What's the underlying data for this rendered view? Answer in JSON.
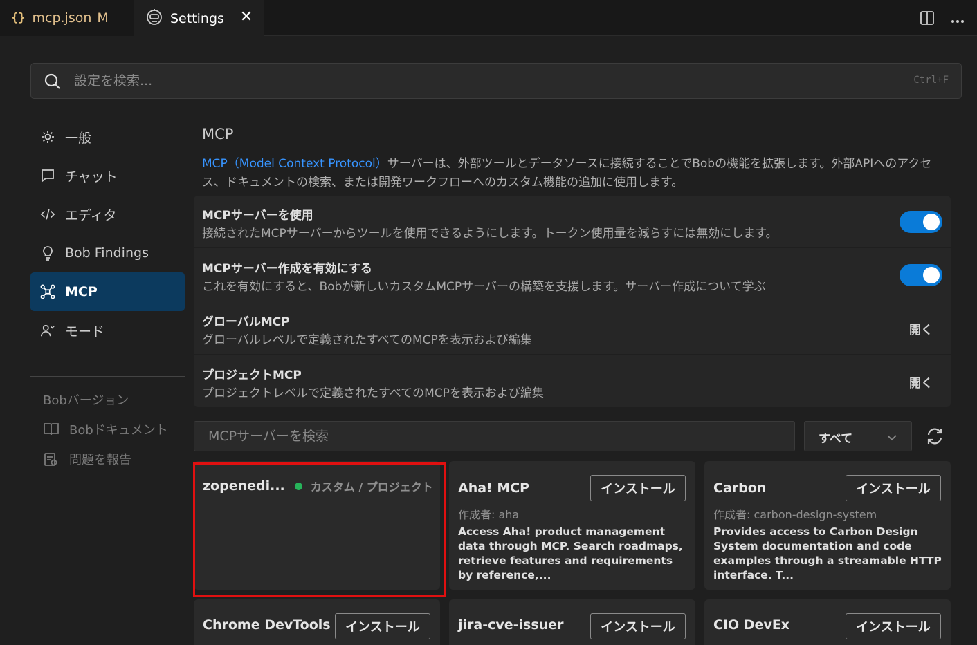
{
  "tabs": [
    {
      "icon": "json-braces-icon",
      "label": "mcp.json",
      "modified": "M"
    },
    {
      "icon": "settings-robot-icon",
      "label": "Settings",
      "close": "✕"
    }
  ],
  "search": {
    "placeholder": "設定を検索...",
    "shortcut": "Ctrl+F"
  },
  "sidebar": {
    "items": [
      {
        "icon": "gear-icon",
        "label": "一般"
      },
      {
        "icon": "chat-icon",
        "label": "チャット"
      },
      {
        "icon": "code-icon",
        "label": "エディタ"
      },
      {
        "icon": "lightbulb-icon",
        "label": "Bob Findings"
      },
      {
        "icon": "mcp-icon",
        "label": "MCP",
        "active": true
      },
      {
        "icon": "person-icon",
        "label": "モード"
      }
    ],
    "version": "Bobバージョン",
    "links": [
      {
        "icon": "book-icon",
        "label": "Bobドキュメント"
      },
      {
        "icon": "report-icon",
        "label": "問題を報告"
      }
    ]
  },
  "main": {
    "title": "MCP",
    "desc_link": "MCP（Model Context Protocol）",
    "desc_rest": "サーバーは、外部ツールとデータソースに接続することでBobの機能を拡張します。外部APIへのアクセス、ドキュメントの検索、または開発ワークフローへのカスタム機能の追加に使用します。",
    "settings": [
      {
        "title": "MCPサーバーを使用",
        "desc": "接続されたMCPサーバーからツールを使用できるようにします。トークン使用量を減らすには無効にします。",
        "toggle": true
      },
      {
        "title": "MCPサーバー作成を有効にする",
        "desc": "これを有効にすると、Bobが新しいカスタムMCPサーバーの構築を支援します。サーバー作成について学ぶ",
        "toggle": true
      },
      {
        "title": "グローバルMCP",
        "desc": "グローバルレベルで定義されたすべてのMCPを表示および編集",
        "action": "開く"
      },
      {
        "title": "プロジェクトMCP",
        "desc": "プロジェクトレベルで定義されたすべてのMCPを表示および編集",
        "action": "開く"
      }
    ],
    "server_search_placeholder": "MCPサーバーを検索",
    "filter_value": "すべて",
    "cards": [
      {
        "name": "zopenedi...",
        "status": "active",
        "tag": "カスタム / プロジェクト"
      },
      {
        "name": "Aha! MCP",
        "install": "インストール",
        "author": "作成者: aha",
        "desc": "Access Aha! product management data through MCP. Search roadmaps, retrieve features and requirements by reference,..."
      },
      {
        "name": "Carbon",
        "install": "インストール",
        "author": "作成者: carbon-design-system",
        "desc": "Provides access to Carbon Design System documentation and code examples through a streamable HTTP interface. T..."
      },
      {
        "name": "Chrome DevTools",
        "install": "インストール"
      },
      {
        "name": "jira-cve-issuer",
        "install": "インストール"
      },
      {
        "name": "CIO DevEx",
        "install": "インストール"
      }
    ]
  },
  "colors": {
    "accent": "#0a7bd8",
    "active_nav": "#0c3a5e",
    "status_green": "#27b35a",
    "highlight": "#e01010",
    "link": "#3794ff"
  }
}
